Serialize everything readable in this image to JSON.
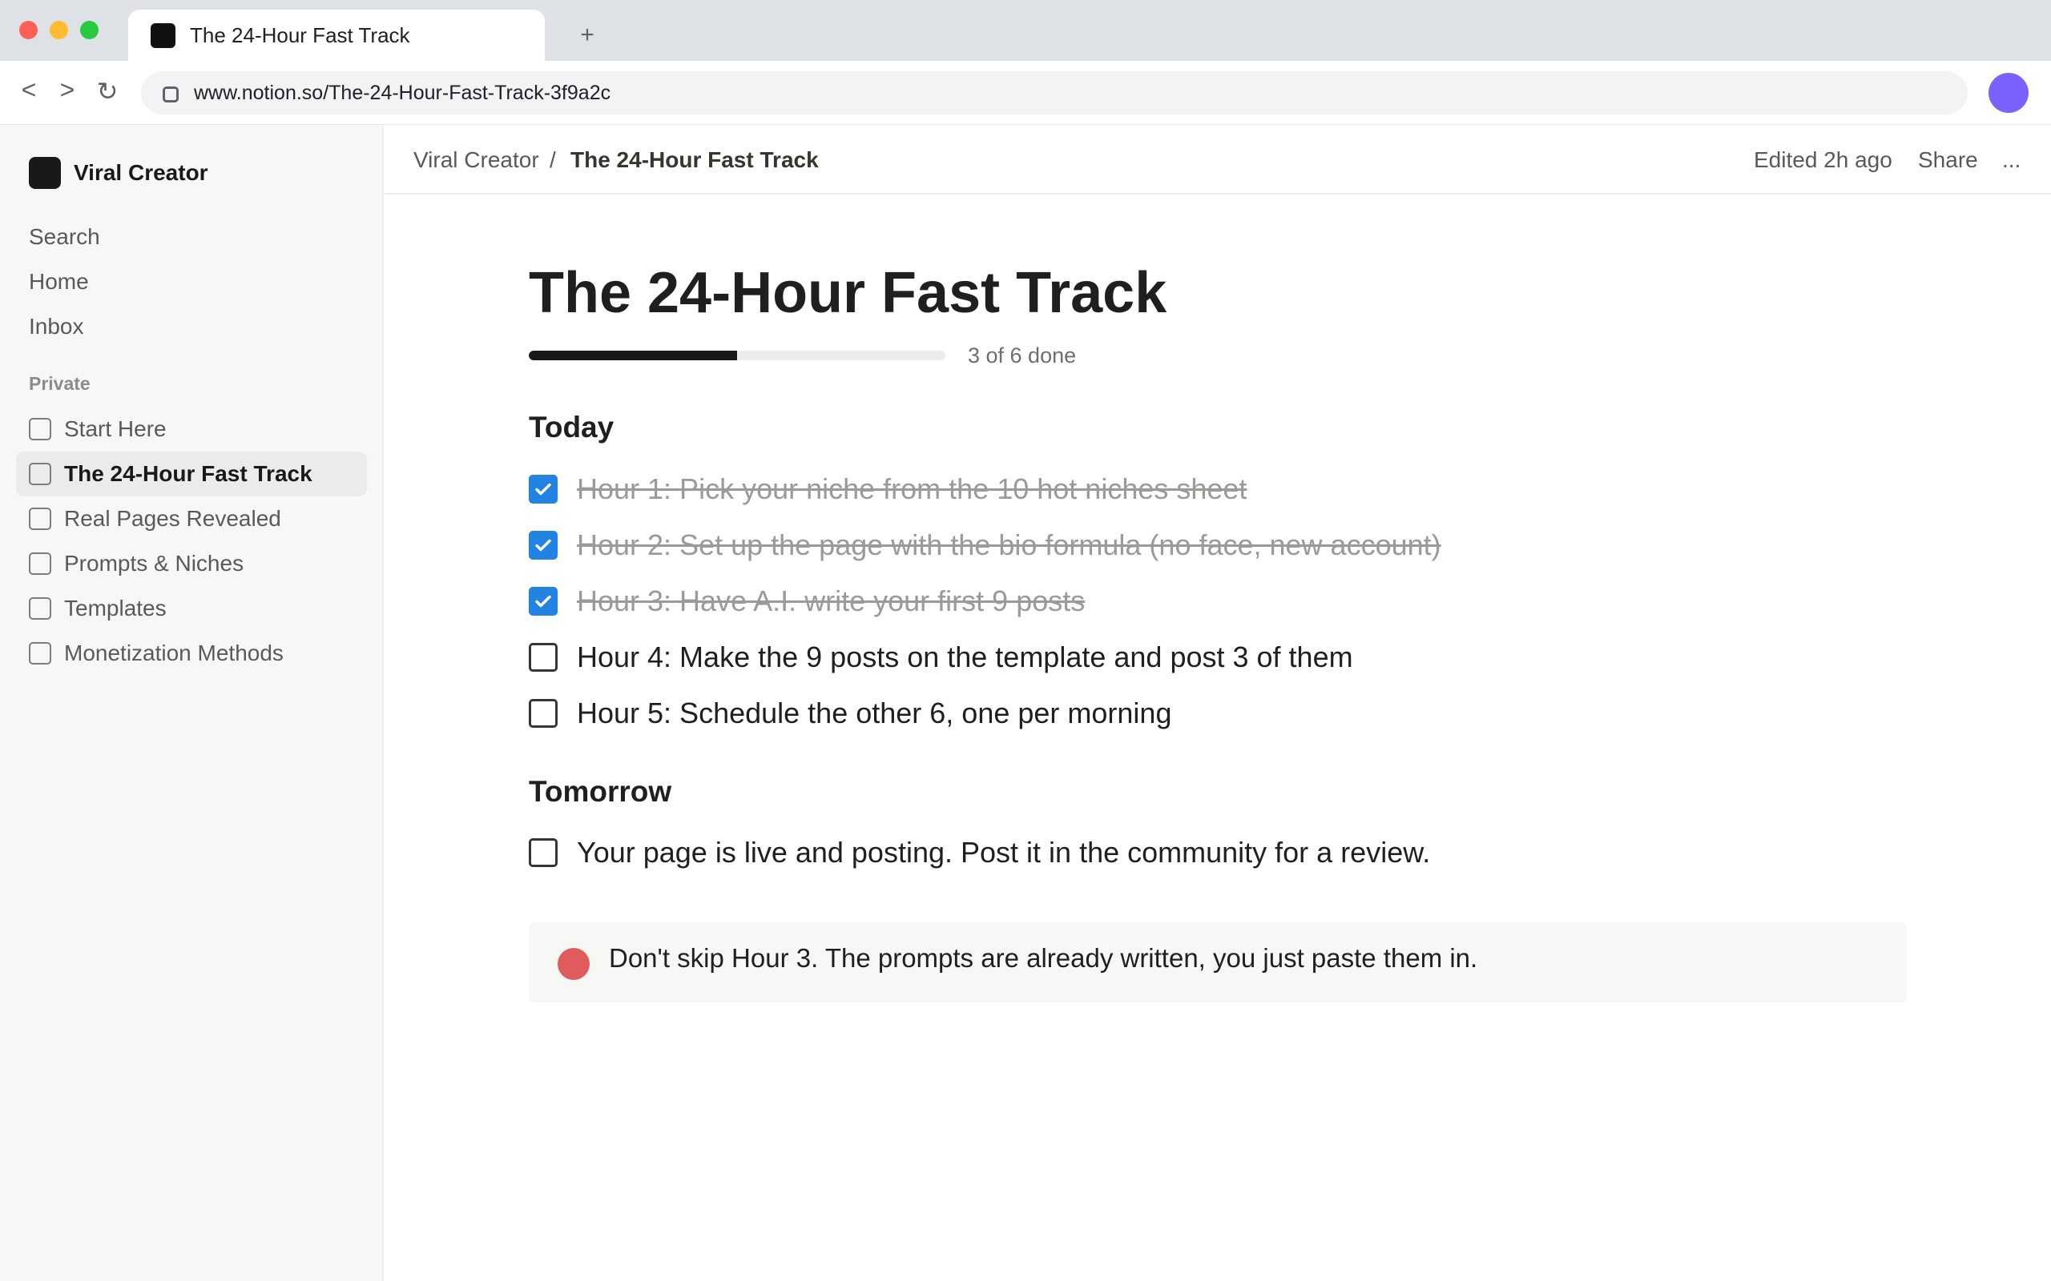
{
  "browser": {
    "tab_title": "The 24-Hour Fast Track",
    "new_tab_symbol": "+",
    "nav": {
      "back": "<",
      "forward": ">",
      "reload": "↻"
    },
    "url": "www.notion.so/The-24-Hour-Fast-Track-3f9a2c",
    "profile_color": "#7b61ff"
  },
  "sidebar": {
    "workspace_name": "Viral Creator",
    "links": [
      "Search",
      "Home",
      "Inbox"
    ],
    "section_label": "Private",
    "pages": [
      {
        "label": "Start Here",
        "active": false
      },
      {
        "label": "The 24-Hour Fast Track",
        "active": true
      },
      {
        "label": "Real Pages Revealed",
        "active": false
      },
      {
        "label": "Prompts & Niches",
        "active": false
      },
      {
        "label": "Templates",
        "active": false
      },
      {
        "label": "Monetization Methods",
        "active": false
      }
    ]
  },
  "topbar": {
    "breadcrumb_parent": "Viral Creator",
    "breadcrumb_separator": "/",
    "breadcrumb_current": "The 24-Hour Fast Track",
    "edited": "Edited 2h ago",
    "share": "Share",
    "more": "..."
  },
  "page": {
    "title": "The 24-Hour Fast Track",
    "progress": {
      "done": 3,
      "total": 6,
      "label": "3 of 6 done"
    },
    "today": {
      "heading": "Today",
      "items": [
        {
          "text": "Hour 1: Pick your niche from the 10 hot niches sheet",
          "checked": true
        },
        {
          "text": "Hour 2: Set up the page with the bio formula (no face, new account)",
          "checked": true
        },
        {
          "text": "Hour 3: Have A.I. write your first 9 posts",
          "checked": true
        },
        {
          "text": "Hour 4: Make the 9 posts on the template and post 3 of them",
          "checked": false
        },
        {
          "text": "Hour 5: Schedule the other 6, one per morning",
          "checked": false
        }
      ]
    },
    "tomorrow": {
      "heading": "Tomorrow",
      "items": [
        {
          "text": "Your page is live and posting. Post it in the community for a review.",
          "checked": false
        }
      ]
    },
    "callout": {
      "text": "Don't skip Hour 3. The prompts are already written, you just paste them in.",
      "dot_color": "#e05c5c"
    }
  },
  "colors": {
    "checkbox_checked": "#2383e2",
    "progress_fill": "#191919"
  }
}
